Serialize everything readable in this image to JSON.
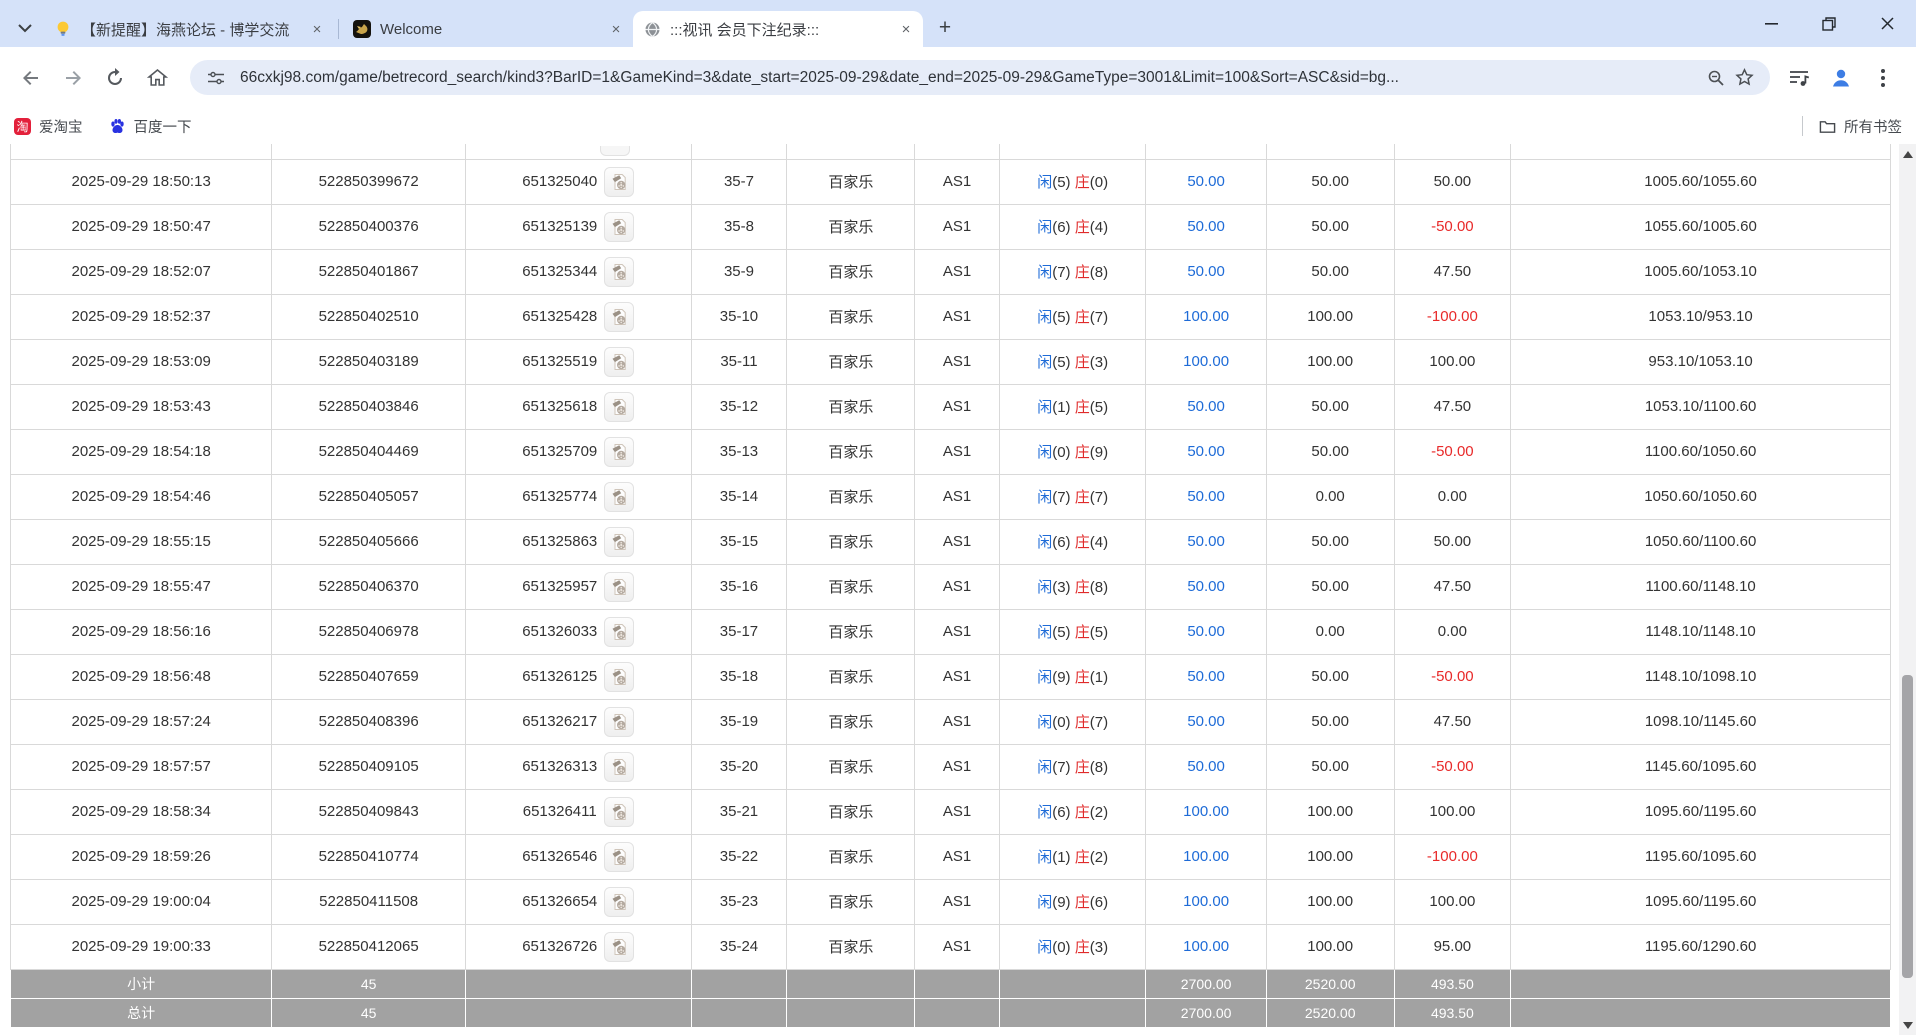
{
  "colors": {
    "link-blue": "#1e6bd7",
    "player-blue": "#1e6bd7",
    "banker-red": "#e02b2b",
    "loss-red": "#e82a2a",
    "summary-gray": "#a2a2a2",
    "chrome-frame": "#d5e2f9"
  },
  "browser": {
    "tabs": [
      {
        "title": "【新提醒】海燕论坛 - 博学交流",
        "favicon": "lightbulb"
      },
      {
        "title": "Welcome",
        "favicon": "dark-pegasus"
      },
      {
        "title": ":::视讯 会员下注纪录:::",
        "favicon": "globe"
      }
    ],
    "close_glyph": "×",
    "new_tab_glyph": "+",
    "url": "66cxkj98.com/game/betrecord_search/kind3?BarID=1&GameKind=3&date_start=2025-09-29&date_end=2025-09-29&GameType=3001&Limit=100&Sort=ASC&sid=bg...",
    "bookmarks": [
      {
        "label": "爱淘宝",
        "icon": "taobao",
        "icon_glyph": "淘"
      },
      {
        "label": "百度一下",
        "icon": "baidu-paw"
      }
    ],
    "all_bookmarks_label": "所有书签"
  },
  "table": {
    "labels": {
      "player": "闲",
      "banker": "庄"
    },
    "rows": [
      {
        "time": "2025-09-29 18:50:13",
        "bet_no": "522850399672",
        "round_no": "651325040",
        "round": "35-7",
        "game": "百家乐",
        "table": "AS1",
        "player": "5",
        "banker": "0",
        "bet": "50.00",
        "valid": "50.00",
        "result": "50.00",
        "balance": "1005.60/1055.60"
      },
      {
        "time": "2025-09-29 18:50:47",
        "bet_no": "522850400376",
        "round_no": "651325139",
        "round": "35-8",
        "game": "百家乐",
        "table": "AS1",
        "player": "6",
        "banker": "4",
        "bet": "50.00",
        "valid": "50.00",
        "result": "-50.00",
        "balance": "1055.60/1005.60"
      },
      {
        "time": "2025-09-29 18:52:07",
        "bet_no": "522850401867",
        "round_no": "651325344",
        "round": "35-9",
        "game": "百家乐",
        "table": "AS1",
        "player": "7",
        "banker": "8",
        "bet": "50.00",
        "valid": "50.00",
        "result": "47.50",
        "balance": "1005.60/1053.10"
      },
      {
        "time": "2025-09-29 18:52:37",
        "bet_no": "522850402510",
        "round_no": "651325428",
        "round": "35-10",
        "game": "百家乐",
        "table": "AS1",
        "player": "5",
        "banker": "7",
        "bet": "100.00",
        "valid": "100.00",
        "result": "-100.00",
        "balance": "1053.10/953.10"
      },
      {
        "time": "2025-09-29 18:53:09",
        "bet_no": "522850403189",
        "round_no": "651325519",
        "round": "35-11",
        "game": "百家乐",
        "table": "AS1",
        "player": "5",
        "banker": "3",
        "bet": "100.00",
        "valid": "100.00",
        "result": "100.00",
        "balance": "953.10/1053.10"
      },
      {
        "time": "2025-09-29 18:53:43",
        "bet_no": "522850403846",
        "round_no": "651325618",
        "round": "35-12",
        "game": "百家乐",
        "table": "AS1",
        "player": "1",
        "banker": "5",
        "bet": "50.00",
        "valid": "50.00",
        "result": "47.50",
        "balance": "1053.10/1100.60"
      },
      {
        "time": "2025-09-29 18:54:18",
        "bet_no": "522850404469",
        "round_no": "651325709",
        "round": "35-13",
        "game": "百家乐",
        "table": "AS1",
        "player": "0",
        "banker": "9",
        "bet": "50.00",
        "valid": "50.00",
        "result": "-50.00",
        "balance": "1100.60/1050.60"
      },
      {
        "time": "2025-09-29 18:54:46",
        "bet_no": "522850405057",
        "round_no": "651325774",
        "round": "35-14",
        "game": "百家乐",
        "table": "AS1",
        "player": "7",
        "banker": "7",
        "bet": "50.00",
        "valid": "0.00",
        "result": "0.00",
        "balance": "1050.60/1050.60"
      },
      {
        "time": "2025-09-29 18:55:15",
        "bet_no": "522850405666",
        "round_no": "651325863",
        "round": "35-15",
        "game": "百家乐",
        "table": "AS1",
        "player": "6",
        "banker": "4",
        "bet": "50.00",
        "valid": "50.00",
        "result": "50.00",
        "balance": "1050.60/1100.60"
      },
      {
        "time": "2025-09-29 18:55:47",
        "bet_no": "522850406370",
        "round_no": "651325957",
        "round": "35-16",
        "game": "百家乐",
        "table": "AS1",
        "player": "3",
        "banker": "8",
        "bet": "50.00",
        "valid": "50.00",
        "result": "47.50",
        "balance": "1100.60/1148.10"
      },
      {
        "time": "2025-09-29 18:56:16",
        "bet_no": "522850406978",
        "round_no": "651326033",
        "round": "35-17",
        "game": "百家乐",
        "table": "AS1",
        "player": "5",
        "banker": "5",
        "bet": "50.00",
        "valid": "0.00",
        "result": "0.00",
        "balance": "1148.10/1148.10"
      },
      {
        "time": "2025-09-29 18:56:48",
        "bet_no": "522850407659",
        "round_no": "651326125",
        "round": "35-18",
        "game": "百家乐",
        "table": "AS1",
        "player": "9",
        "banker": "1",
        "bet": "50.00",
        "valid": "50.00",
        "result": "-50.00",
        "balance": "1148.10/1098.10"
      },
      {
        "time": "2025-09-29 18:57:24",
        "bet_no": "522850408396",
        "round_no": "651326217",
        "round": "35-19",
        "game": "百家乐",
        "table": "AS1",
        "player": "0",
        "banker": "7",
        "bet": "50.00",
        "valid": "50.00",
        "result": "47.50",
        "balance": "1098.10/1145.60"
      },
      {
        "time": "2025-09-29 18:57:57",
        "bet_no": "522850409105",
        "round_no": "651326313",
        "round": "35-20",
        "game": "百家乐",
        "table": "AS1",
        "player": "7",
        "banker": "8",
        "bet": "50.00",
        "valid": "50.00",
        "result": "-50.00",
        "balance": "1145.60/1095.60"
      },
      {
        "time": "2025-09-29 18:58:34",
        "bet_no": "522850409843",
        "round_no": "651326411",
        "round": "35-21",
        "game": "百家乐",
        "table": "AS1",
        "player": "6",
        "banker": "2",
        "bet": "100.00",
        "valid": "100.00",
        "result": "100.00",
        "balance": "1095.60/1195.60"
      },
      {
        "time": "2025-09-29 18:59:26",
        "bet_no": "522850410774",
        "round_no": "651326546",
        "round": "35-22",
        "game": "百家乐",
        "table": "AS1",
        "player": "1",
        "banker": "2",
        "bet": "100.00",
        "valid": "100.00",
        "result": "-100.00",
        "balance": "1195.60/1095.60"
      },
      {
        "time": "2025-09-29 19:00:04",
        "bet_no": "522850411508",
        "round_no": "651326654",
        "round": "35-23",
        "game": "百家乐",
        "table": "AS1",
        "player": "9",
        "banker": "6",
        "bet": "100.00",
        "valid": "100.00",
        "result": "100.00",
        "balance": "1095.60/1195.60"
      },
      {
        "time": "2025-09-29 19:00:33",
        "bet_no": "522850412065",
        "round_no": "651326726",
        "round": "35-24",
        "game": "百家乐",
        "table": "AS1",
        "player": "0",
        "banker": "3",
        "bet": "100.00",
        "valid": "100.00",
        "result": "95.00",
        "balance": "1195.60/1290.60"
      }
    ],
    "subtotal": {
      "label": "小计",
      "count": "45",
      "bet": "2700.00",
      "valid": "2520.00",
      "result": "493.50"
    },
    "total": {
      "label": "总计",
      "count": "45",
      "bet": "2700.00",
      "valid": "2520.00",
      "result": "493.50"
    }
  }
}
